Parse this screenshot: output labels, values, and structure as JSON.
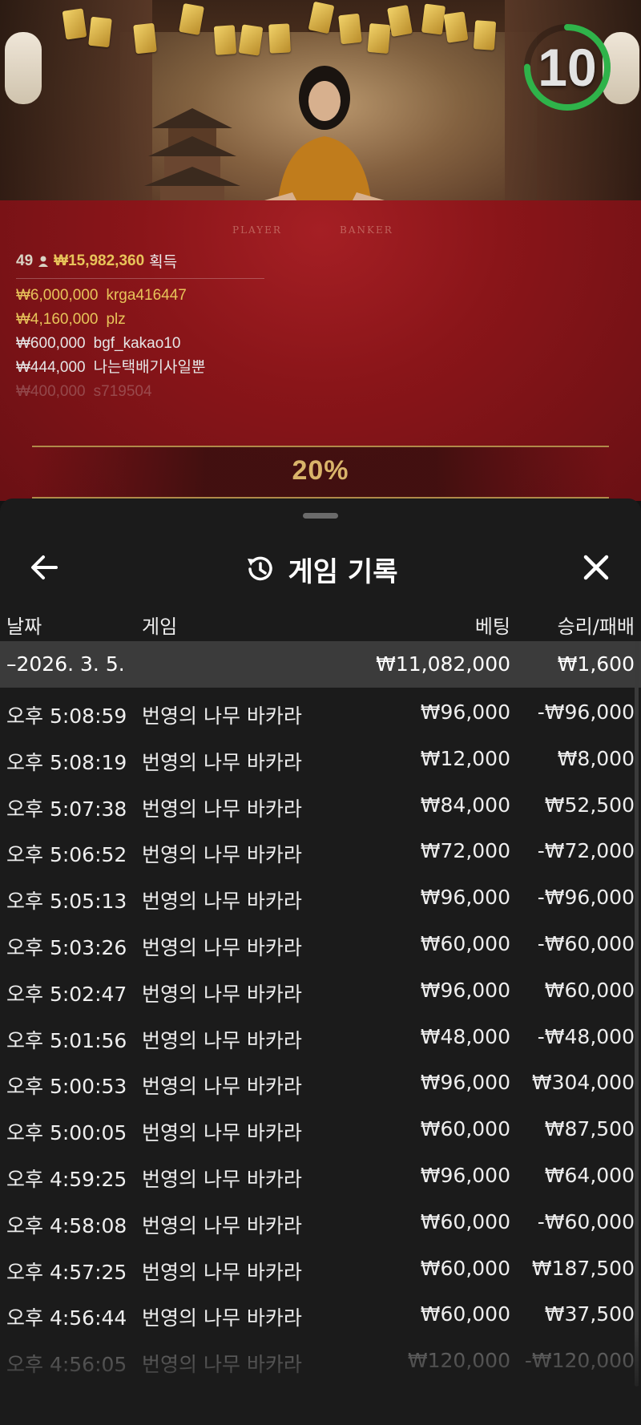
{
  "timer": {
    "value": "10",
    "progress_fraction": 0.75
  },
  "table": {
    "player_label": "PLAYER",
    "banker_label": "BANKER"
  },
  "winners": {
    "count": "49",
    "total": "₩15,982,360",
    "total_label": "획득",
    "rows": [
      {
        "amount": "₩6,000,000",
        "name": "krga416447"
      },
      {
        "amount": "₩4,160,000",
        "name": "plz"
      },
      {
        "amount": "₩600,000",
        "name": "bgf_kakao10"
      },
      {
        "amount": "₩444,000",
        "name": "나는택배기사일뿐"
      },
      {
        "amount": "₩400,000",
        "name": "s719504"
      }
    ]
  },
  "payout_percent": "20%",
  "history": {
    "title": "게임 기록",
    "columns": {
      "date": "날짜",
      "game": "게임",
      "bet": "베팅",
      "result": "승리/패배"
    },
    "summary": {
      "date": "–2026. 3. 5.",
      "bet": "₩11,082,000",
      "result": "₩1,600"
    },
    "rows": [
      {
        "time": "오후 5:08:59",
        "game": "번영의 나무 바카라",
        "bet": "₩96,000",
        "result": "-₩96,000"
      },
      {
        "time": "오후 5:08:19",
        "game": "번영의 나무 바카라",
        "bet": "₩12,000",
        "result": "₩8,000"
      },
      {
        "time": "오후 5:07:38",
        "game": "번영의 나무 바카라",
        "bet": "₩84,000",
        "result": "₩52,500"
      },
      {
        "time": "오후 5:06:52",
        "game": "번영의 나무 바카라",
        "bet": "₩72,000",
        "result": "-₩72,000"
      },
      {
        "time": "오후 5:05:13",
        "game": "번영의 나무 바카라",
        "bet": "₩96,000",
        "result": "-₩96,000"
      },
      {
        "time": "오후 5:03:26",
        "game": "번영의 나무 바카라",
        "bet": "₩60,000",
        "result": "-₩60,000"
      },
      {
        "time": "오후 5:02:47",
        "game": "번영의 나무 바카라",
        "bet": "₩96,000",
        "result": "₩60,000"
      },
      {
        "time": "오후 5:01:56",
        "game": "번영의 나무 바카라",
        "bet": "₩48,000",
        "result": "-₩48,000"
      },
      {
        "time": "오후 5:00:53",
        "game": "번영의 나무 바카라",
        "bet": "₩96,000",
        "result": "₩304,000"
      },
      {
        "time": "오후 5:00:05",
        "game": "번영의 나무 바카라",
        "bet": "₩60,000",
        "result": "₩87,500"
      },
      {
        "time": "오후 4:59:25",
        "game": "번영의 나무 바카라",
        "bet": "₩96,000",
        "result": "₩64,000"
      },
      {
        "time": "오후 4:58:08",
        "game": "번영의 나무 바카라",
        "bet": "₩60,000",
        "result": "-₩60,000"
      },
      {
        "time": "오후 4:57:25",
        "game": "번영의 나무 바카라",
        "bet": "₩60,000",
        "result": "₩187,500"
      },
      {
        "time": "오후 4:56:44",
        "game": "번영의 나무 바카라",
        "bet": "₩60,000",
        "result": "₩37,500"
      },
      {
        "time": "오후 4:56:05",
        "game": "번영의 나무 바카라",
        "bet": "₩120,000",
        "result": "-₩120,000"
      }
    ]
  },
  "icons": {
    "back": "arrow-left-icon",
    "history": "history-clock-icon",
    "close": "close-icon",
    "person": "person-icon"
  },
  "colors": {
    "gold": "#e8c45a",
    "timer_green": "#2fb34a",
    "sheet_bg": "#1b1b1b",
    "summary_bg": "#3b3b3b"
  }
}
